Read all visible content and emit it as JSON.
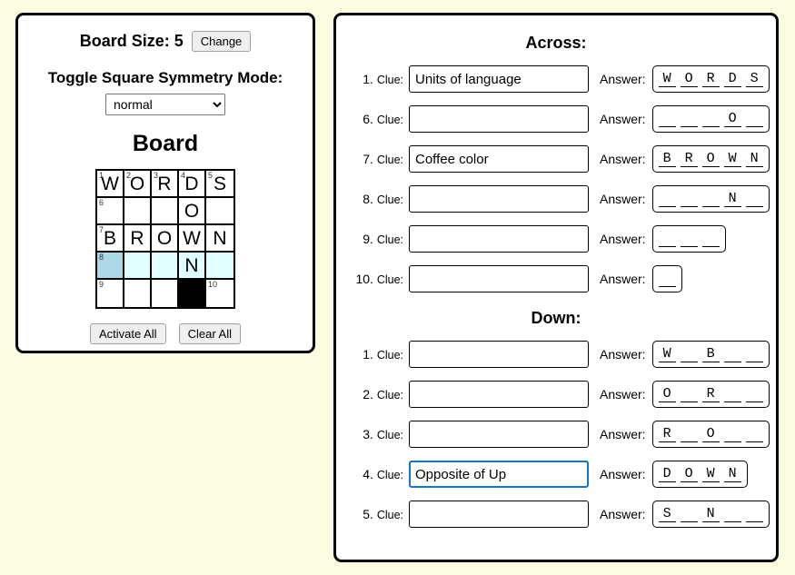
{
  "colors": {
    "page_background": "#fcfce0",
    "panel_background": "#ffffff",
    "panel_border": "#000000",
    "cell_highlight": "#e0ffff",
    "cell_active": "#add8e6",
    "cell_blocked": "#000000",
    "focus_outline": "#1a73c8"
  },
  "left_panel": {
    "board_size_label": "Board Size: 5",
    "change_button": "Change",
    "symmetry_heading": "Toggle Square Symmetry Mode:",
    "symmetry_select": {
      "value": "normal",
      "options": [
        "normal"
      ]
    },
    "board_heading": "Board",
    "activate_all_button": "Activate All",
    "clear_all_button": "Clear All"
  },
  "board": {
    "size": 5,
    "cells": [
      {
        "letter": "W",
        "number": "1",
        "state": "normal"
      },
      {
        "letter": "O",
        "number": "2",
        "state": "normal"
      },
      {
        "letter": "R",
        "number": "3",
        "state": "normal"
      },
      {
        "letter": "D",
        "number": "4",
        "state": "normal"
      },
      {
        "letter": "S",
        "number": "5",
        "state": "normal"
      },
      {
        "letter": "",
        "number": "6",
        "state": "normal"
      },
      {
        "letter": "",
        "number": "",
        "state": "normal"
      },
      {
        "letter": "",
        "number": "",
        "state": "normal"
      },
      {
        "letter": "O",
        "number": "",
        "state": "normal"
      },
      {
        "letter": "",
        "number": "",
        "state": "normal"
      },
      {
        "letter": "B",
        "number": "7",
        "state": "normal"
      },
      {
        "letter": "R",
        "number": "",
        "state": "normal"
      },
      {
        "letter": "O",
        "number": "",
        "state": "normal"
      },
      {
        "letter": "W",
        "number": "",
        "state": "normal"
      },
      {
        "letter": "N",
        "number": "",
        "state": "normal"
      },
      {
        "letter": "",
        "number": "8",
        "state": "active"
      },
      {
        "letter": "",
        "number": "",
        "state": "highlight"
      },
      {
        "letter": "",
        "number": "",
        "state": "highlight"
      },
      {
        "letter": "N",
        "number": "",
        "state": "highlight"
      },
      {
        "letter": "",
        "number": "",
        "state": "highlight"
      },
      {
        "letter": "",
        "number": "9",
        "state": "normal"
      },
      {
        "letter": "",
        "number": "",
        "state": "normal"
      },
      {
        "letter": "",
        "number": "",
        "state": "normal"
      },
      {
        "letter": "",
        "number": "",
        "state": "blocked"
      },
      {
        "letter": "",
        "number": "10",
        "state": "normal"
      }
    ]
  },
  "right_panel": {
    "across_heading": "Across:",
    "down_heading": "Down:",
    "clue_word": "Clue:",
    "answer_word": "Answer:",
    "clue_placeholder": "",
    "across": [
      {
        "number": "1.",
        "clue": "Units of language",
        "focused": false,
        "answer": [
          "W",
          "O",
          "R",
          "D",
          "S"
        ]
      },
      {
        "number": "6.",
        "clue": "",
        "focused": false,
        "answer": [
          "",
          "",
          "",
          "O",
          ""
        ]
      },
      {
        "number": "7.",
        "clue": "Coffee color",
        "focused": false,
        "answer": [
          "B",
          "R",
          "O",
          "W",
          "N"
        ]
      },
      {
        "number": "8.",
        "clue": "",
        "focused": false,
        "answer": [
          "",
          "",
          "",
          "N",
          ""
        ]
      },
      {
        "number": "9.",
        "clue": "",
        "focused": false,
        "answer": [
          "",
          "",
          ""
        ]
      },
      {
        "number": "10.",
        "clue": "",
        "focused": false,
        "answer": [
          ""
        ]
      }
    ],
    "down": [
      {
        "number": "1.",
        "clue": "",
        "focused": false,
        "answer": [
          "W",
          "",
          "B",
          "",
          ""
        ]
      },
      {
        "number": "2.",
        "clue": "",
        "focused": false,
        "answer": [
          "O",
          "",
          "R",
          "",
          ""
        ]
      },
      {
        "number": "3.",
        "clue": "",
        "focused": false,
        "answer": [
          "R",
          "",
          "O",
          "",
          ""
        ]
      },
      {
        "number": "4.",
        "clue": "Opposite of Up",
        "focused": true,
        "answer": [
          "D",
          "O",
          "W",
          "N"
        ]
      },
      {
        "number": "5.",
        "clue": "",
        "focused": false,
        "answer": [
          "S",
          "",
          "N",
          "",
          ""
        ]
      }
    ]
  }
}
